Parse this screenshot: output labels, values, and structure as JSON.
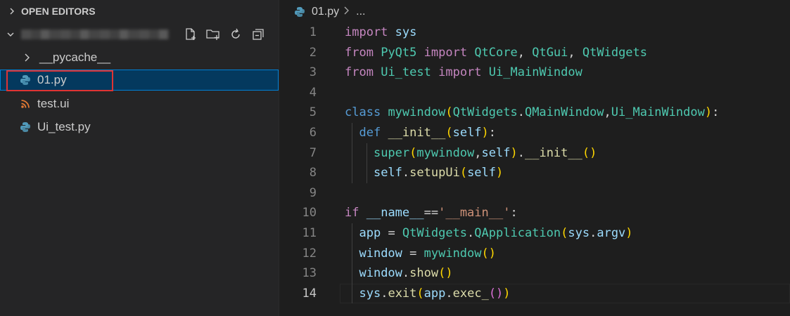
{
  "explorer": {
    "section_title": "OPEN EDITORS",
    "files": [
      {
        "label": "__pycache__",
        "type": "folder",
        "icon": "chevron-right-icon"
      },
      {
        "label": "01.py",
        "type": "python",
        "icon": "python-icon",
        "selected": true
      },
      {
        "label": "test.ui",
        "type": "rss",
        "icon": "rss-icon"
      },
      {
        "label": "Ui_test.py",
        "type": "python",
        "icon": "python-icon"
      }
    ],
    "actions": [
      "new-file-icon",
      "new-folder-icon",
      "refresh-icon",
      "collapse-all-icon"
    ]
  },
  "breadcrumb": {
    "file": "01.py",
    "more": "..."
  },
  "editor": {
    "active_line": 14,
    "lines": [
      {
        "n": "1",
        "tokens": [
          {
            "t": "import",
            "c": "kw2"
          },
          {
            "t": " ",
            "c": "op"
          },
          {
            "t": "sys",
            "c": "id"
          }
        ]
      },
      {
        "n": "2",
        "tokens": [
          {
            "t": "from",
            "c": "kw2"
          },
          {
            "t": " ",
            "c": "op"
          },
          {
            "t": "PyQt5",
            "c": "cls"
          },
          {
            "t": " ",
            "c": "op"
          },
          {
            "t": "import",
            "c": "kw2"
          },
          {
            "t": " ",
            "c": "op"
          },
          {
            "t": "QtCore",
            "c": "cls"
          },
          {
            "t": ", ",
            "c": "op"
          },
          {
            "t": "QtGui",
            "c": "cls"
          },
          {
            "t": ", ",
            "c": "op"
          },
          {
            "t": "QtWidgets",
            "c": "cls"
          }
        ]
      },
      {
        "n": "3",
        "tokens": [
          {
            "t": "from",
            "c": "kw2"
          },
          {
            "t": " ",
            "c": "op"
          },
          {
            "t": "Ui_test",
            "c": "cls"
          },
          {
            "t": " ",
            "c": "op"
          },
          {
            "t": "import",
            "c": "kw2"
          },
          {
            "t": " ",
            "c": "op"
          },
          {
            "t": "Ui_MainWindow",
            "c": "cls"
          }
        ]
      },
      {
        "n": "4",
        "tokens": []
      },
      {
        "n": "5",
        "tokens": [
          {
            "t": "class",
            "c": "kw"
          },
          {
            "t": " ",
            "c": "op"
          },
          {
            "t": "mywindow",
            "c": "cls"
          },
          {
            "t": "(",
            "c": "br"
          },
          {
            "t": "QtWidgets",
            "c": "cls"
          },
          {
            "t": ".",
            "c": "op"
          },
          {
            "t": "QMainWindow",
            "c": "cls"
          },
          {
            "t": ",",
            "c": "op"
          },
          {
            "t": "Ui_MainWindow",
            "c": "cls"
          },
          {
            "t": ")",
            "c": "br"
          },
          {
            "t": ":",
            "c": "op"
          }
        ]
      },
      {
        "n": "6",
        "tokens": [
          {
            "t": "  ",
            "c": "op"
          },
          {
            "t": "def",
            "c": "kw"
          },
          {
            "t": " ",
            "c": "op"
          },
          {
            "t": "__init__",
            "c": "fn"
          },
          {
            "t": "(",
            "c": "br"
          },
          {
            "t": "self",
            "c": "id"
          },
          {
            "t": ")",
            "c": "br"
          },
          {
            "t": ":",
            "c": "op"
          }
        ]
      },
      {
        "n": "7",
        "tokens": [
          {
            "t": "    ",
            "c": "op"
          },
          {
            "t": "super",
            "c": "cls"
          },
          {
            "t": "(",
            "c": "br"
          },
          {
            "t": "mywindow",
            "c": "cls"
          },
          {
            "t": ",",
            "c": "op"
          },
          {
            "t": "self",
            "c": "id"
          },
          {
            "t": ")",
            "c": "br"
          },
          {
            "t": ".",
            "c": "op"
          },
          {
            "t": "__init__",
            "c": "fn"
          },
          {
            "t": "()",
            "c": "br"
          }
        ]
      },
      {
        "n": "8",
        "tokens": [
          {
            "t": "    ",
            "c": "op"
          },
          {
            "t": "self",
            "c": "id"
          },
          {
            "t": ".",
            "c": "op"
          },
          {
            "t": "setupUi",
            "c": "fn"
          },
          {
            "t": "(",
            "c": "br"
          },
          {
            "t": "self",
            "c": "id"
          },
          {
            "t": ")",
            "c": "br"
          }
        ]
      },
      {
        "n": "9",
        "tokens": []
      },
      {
        "n": "10",
        "tokens": [
          {
            "t": "if",
            "c": "kw2"
          },
          {
            "t": " ",
            "c": "op"
          },
          {
            "t": "__name__",
            "c": "id"
          },
          {
            "t": "==",
            "c": "op"
          },
          {
            "t": "'__main__'",
            "c": "str"
          },
          {
            "t": ":",
            "c": "op"
          }
        ]
      },
      {
        "n": "11",
        "tokens": [
          {
            "t": "  ",
            "c": "op"
          },
          {
            "t": "app",
            "c": "id"
          },
          {
            "t": " = ",
            "c": "op"
          },
          {
            "t": "QtWidgets",
            "c": "cls"
          },
          {
            "t": ".",
            "c": "op"
          },
          {
            "t": "QApplication",
            "c": "cls"
          },
          {
            "t": "(",
            "c": "br"
          },
          {
            "t": "sys",
            "c": "id"
          },
          {
            "t": ".",
            "c": "op"
          },
          {
            "t": "argv",
            "c": "id"
          },
          {
            "t": ")",
            "c": "br"
          }
        ]
      },
      {
        "n": "12",
        "tokens": [
          {
            "t": "  ",
            "c": "op"
          },
          {
            "t": "window",
            "c": "id"
          },
          {
            "t": " = ",
            "c": "op"
          },
          {
            "t": "mywindow",
            "c": "cls"
          },
          {
            "t": "()",
            "c": "br"
          }
        ]
      },
      {
        "n": "13",
        "tokens": [
          {
            "t": "  ",
            "c": "op"
          },
          {
            "t": "window",
            "c": "id"
          },
          {
            "t": ".",
            "c": "op"
          },
          {
            "t": "show",
            "c": "fn"
          },
          {
            "t": "()",
            "c": "br"
          }
        ]
      },
      {
        "n": "14",
        "tokens": [
          {
            "t": "  ",
            "c": "op"
          },
          {
            "t": "sys",
            "c": "id"
          },
          {
            "t": ".",
            "c": "op"
          },
          {
            "t": "exit",
            "c": "fn"
          },
          {
            "t": "(",
            "c": "br"
          },
          {
            "t": "app",
            "c": "id"
          },
          {
            "t": ".",
            "c": "op"
          },
          {
            "t": "exec_",
            "c": "fn"
          },
          {
            "t": "()",
            "c": "br2"
          },
          {
            "t": ")",
            "c": "br"
          }
        ]
      }
    ]
  },
  "colors": {
    "sidebar_bg": "#252526",
    "editor_bg": "#1e1e1e",
    "selection_bg": "#04395e",
    "selection_border": "#007fd4",
    "annotation_box": "#e03333"
  }
}
